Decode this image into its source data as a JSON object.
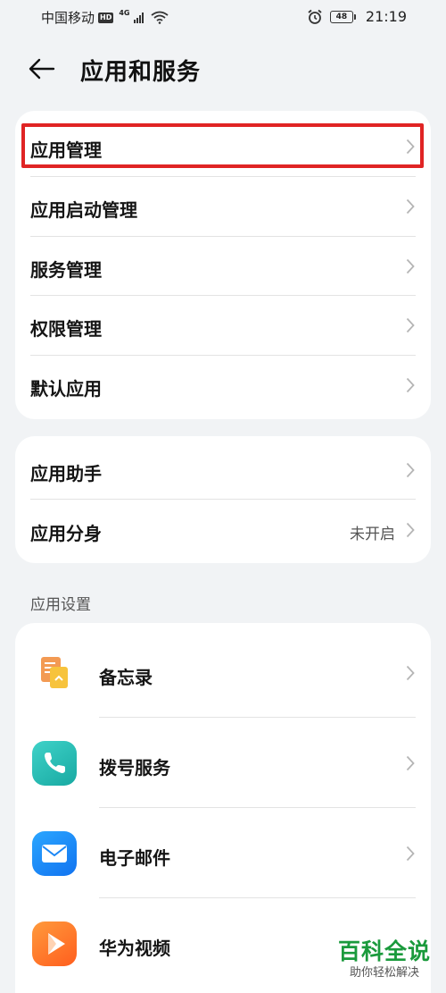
{
  "status_bar": {
    "carrier": "中国移动",
    "hd": "HD",
    "network": "4G",
    "battery": "48",
    "time": "21:19"
  },
  "header": {
    "title": "应用和服务"
  },
  "card1": {
    "items": [
      {
        "label": "应用管理"
      },
      {
        "label": "应用启动管理"
      },
      {
        "label": "服务管理"
      },
      {
        "label": "权限管理"
      },
      {
        "label": "默认应用"
      }
    ]
  },
  "card2": {
    "items": [
      {
        "label": "应用助手"
      },
      {
        "label": "应用分身",
        "value": "未开启"
      }
    ]
  },
  "app_settings": {
    "section_title": "应用设置",
    "apps": [
      {
        "label": "备忘录",
        "icon": "memo-icon"
      },
      {
        "label": "拨号服务",
        "icon": "phone-icon"
      },
      {
        "label": "电子邮件",
        "icon": "email-icon"
      },
      {
        "label": "华为视频",
        "icon": "video-icon"
      }
    ]
  },
  "watermark": {
    "title": "百科全说",
    "subtitle": "助你轻松解决"
  },
  "colors": {
    "background": "#f1f3f5",
    "card": "#ffffff",
    "highlight_border": "#e02424",
    "watermark_green": "#1a9a3c"
  }
}
